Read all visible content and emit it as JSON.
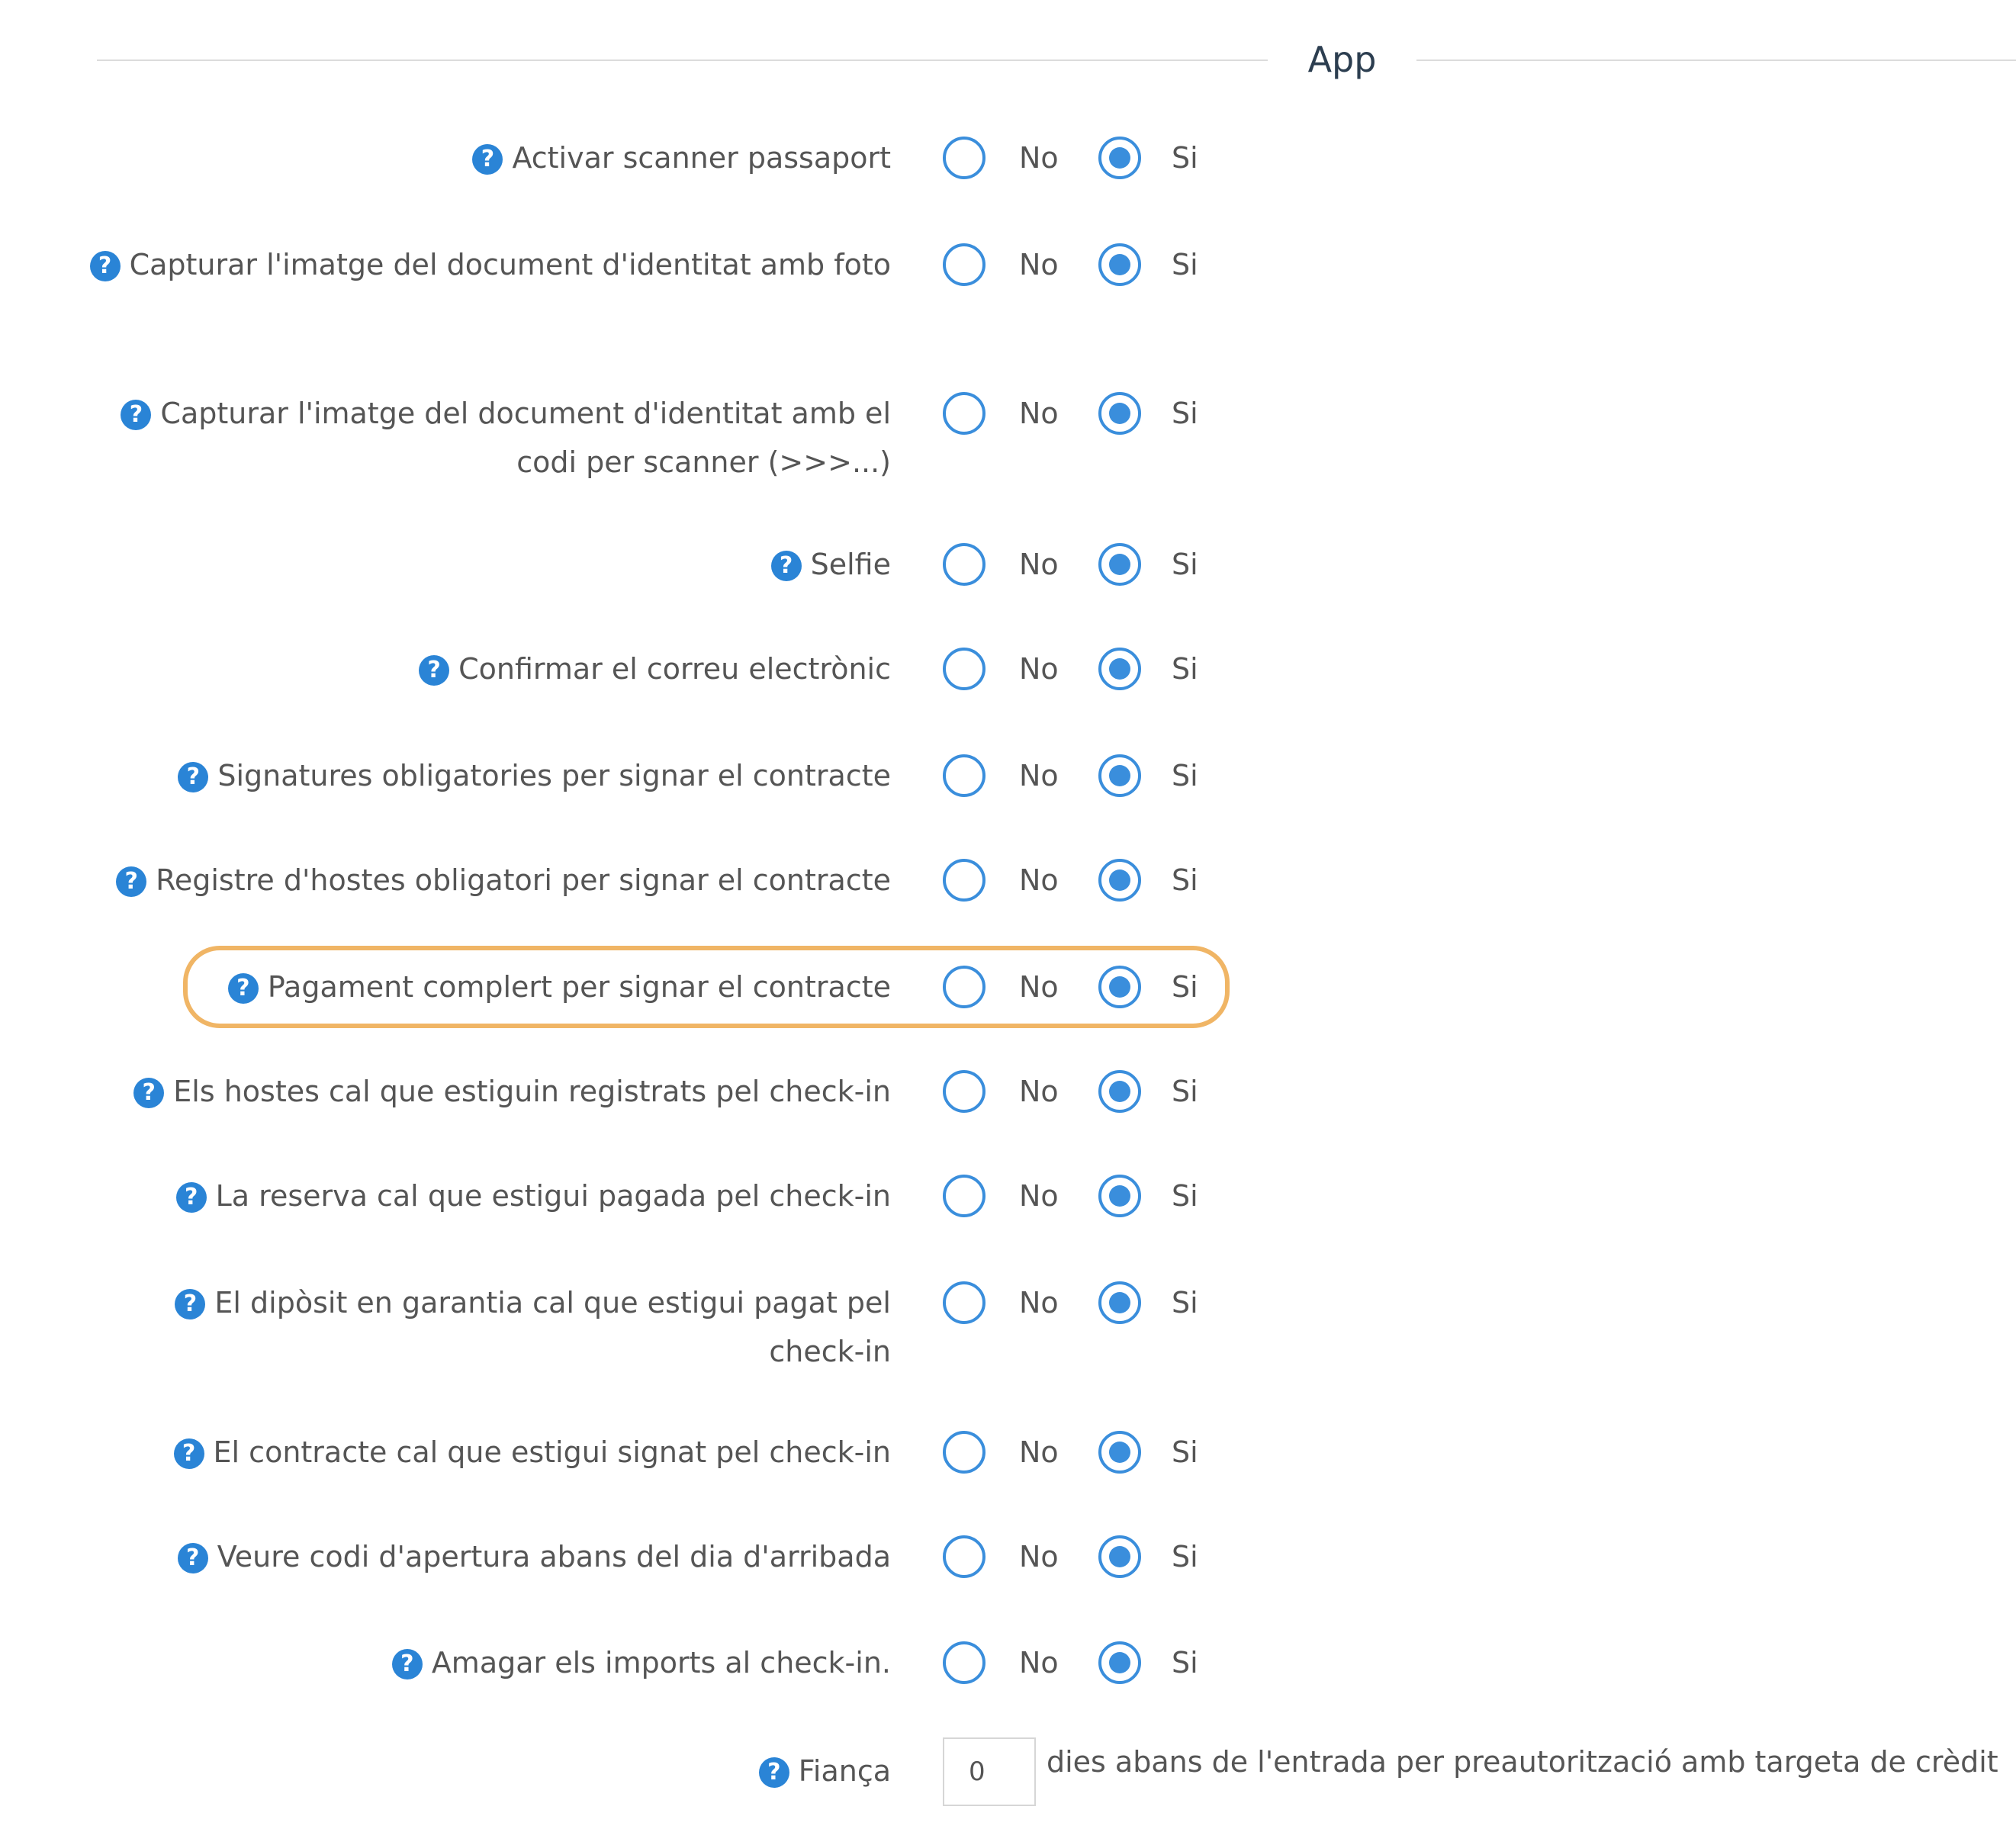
{
  "section": {
    "title": "App"
  },
  "options": {
    "no_label": "No",
    "yes_label": "Si"
  },
  "settings": [
    {
      "label": "Activar scanner passaport",
      "value": "Si"
    },
    {
      "label": "Capturar l'imatge del document d'identitat amb foto",
      "value": "Si"
    },
    {
      "label": "Capturar l'imatge del document d'identitat amb el codi per scanner (>>>...)",
      "value": "Si"
    },
    {
      "label": "Selfie",
      "value": "Si"
    },
    {
      "label": "Confirmar el correu electrònic",
      "value": "Si"
    },
    {
      "label": "Signatures obligatories per signar el contracte",
      "value": "Si"
    },
    {
      "label": "Registre d'hostes obligatori per signar el contracte",
      "value": "Si"
    },
    {
      "label": "Pagament complert per signar el contracte",
      "value": "Si",
      "highlighted": true
    },
    {
      "label": "Els hostes cal que estiguin registrats pel check-in",
      "value": "Si"
    },
    {
      "label": "La reserva cal que estigui pagada pel check-in",
      "value": "Si"
    },
    {
      "label": "El dipòsit en garantia cal que estigui pagat pel check-in",
      "value": "Si"
    },
    {
      "label": "El contracte cal que estigui signat pel check-in",
      "value": "Si"
    },
    {
      "label": "Veure codi d'apertura abans del dia d'arribada",
      "value": "Si"
    },
    {
      "label": "Amagar els imports al check-in.",
      "value": "Si"
    }
  ],
  "deposit": {
    "label": "Fiança",
    "value": "0",
    "suffix": "dies abans de l'entrada per preautorització amb targeta de crèdit"
  },
  "icons": {
    "help": "question-circle-icon"
  },
  "colors": {
    "accent": "#3a8edc",
    "highlight": "#f0b565",
    "help_icon": "#2a84d6"
  }
}
